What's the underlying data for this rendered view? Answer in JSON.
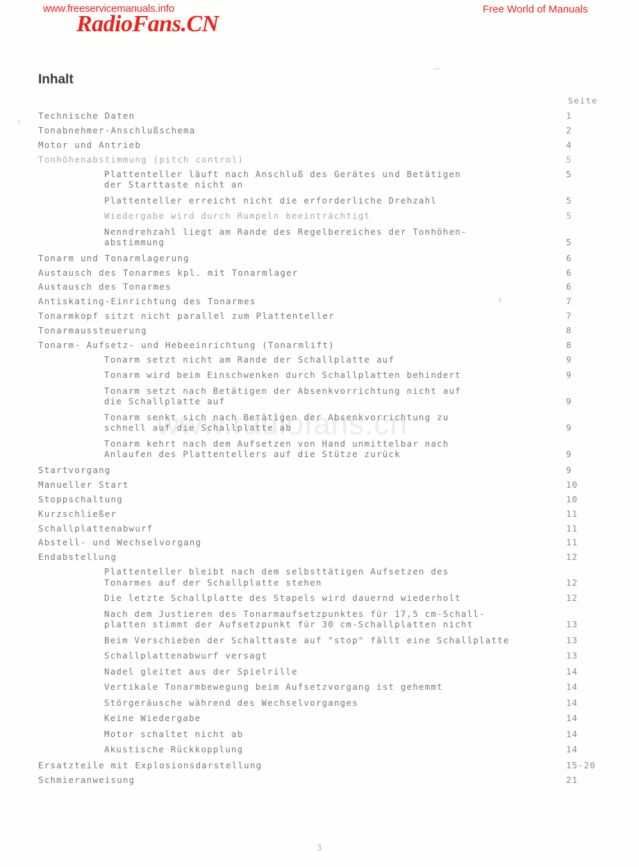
{
  "header": {
    "left_url": "www.freeservicemanuals.info",
    "logo": "RadioFans.CN",
    "right_text": "Free World of Manuals"
  },
  "watermark": "www.radiofans.cn",
  "title": "Inhalt",
  "page_column_header": "Seite",
  "footer_page": "3",
  "entries": [
    {
      "level": 1,
      "lines": [
        "Technische Daten"
      ],
      "page": "1"
    },
    {
      "level": 1,
      "lines": [
        "Tonabnehmer-Anschlußschema"
      ],
      "page": "2"
    },
    {
      "level": 1,
      "lines": [
        "Motor und Antrieb"
      ],
      "page": "4"
    },
    {
      "level": 1,
      "lines": [
        "Tonhöhenabstimmung (pitch control)"
      ],
      "page": "5",
      "faint": true
    },
    {
      "level": 2,
      "lines": [
        "Plattenteller läuft nach Anschluß des Gerätes und Betätigen",
        "der Starttaste nicht an"
      ],
      "page": "5",
      "page_on_line": 0
    },
    {
      "level": 2,
      "lines": [
        "Plattenteller erreicht nicht die erforderliche Drehzahl"
      ],
      "page": "5"
    },
    {
      "level": 2,
      "lines": [
        "Wiedergabe wird durch Rumpeln beeinträchtigt"
      ],
      "page": "5",
      "faint": true
    },
    {
      "level": 2,
      "lines": [
        "Nenndrehzahl liegt am Rande des Regelbereiches der Tonhöhen-",
        "abstimmung"
      ],
      "page": "5",
      "page_on_line": 1
    },
    {
      "level": 1,
      "lines": [
        "Tonarm und Tonarmlagerung"
      ],
      "page": "6"
    },
    {
      "level": 1,
      "lines": [
        "Austausch des Tonarmes kpl. mit Tonarmlager"
      ],
      "page": "6"
    },
    {
      "level": 1,
      "lines": [
        "Austausch des Tonarmes"
      ],
      "page": "6"
    },
    {
      "level": 1,
      "lines": [
        "Antiskating-Einrichtung des Tonarmes"
      ],
      "page": "7"
    },
    {
      "level": 1,
      "lines": [
        "Tonarmkopf sitzt nicht parallel zum Plattenteller"
      ],
      "page": "7"
    },
    {
      "level": 1,
      "lines": [
        "Tonarmaussteuerung"
      ],
      "page": "8"
    },
    {
      "level": 1,
      "lines": [
        "Tonarm- Aufsetz- und Hebeeinrichtung (Tonarmlift)"
      ],
      "page": "8"
    },
    {
      "level": 2,
      "lines": [
        "Tonarm setzt nicht am Rande der Schallplatte auf"
      ],
      "page": "9"
    },
    {
      "level": 2,
      "lines": [
        "Tonarm wird beim Einschwenken durch Schallplatten behindert"
      ],
      "page": "9"
    },
    {
      "level": 2,
      "lines": [
        "Tonarm setzt nach Betätigen der Absenkvorrichtung nicht auf",
        "die Schallplatte auf"
      ],
      "page": "9",
      "page_on_line": 1
    },
    {
      "level": 2,
      "lines": [
        "Tonarm senkt sich nach Betätigen der Absenkvorrichtung zu",
        "schnell auf die Schallplatte ab"
      ],
      "page": "9",
      "page_on_line": 1
    },
    {
      "level": 2,
      "lines": [
        "Tonarm kehrt nach dem Aufsetzen von Hand unmittelbar nach",
        "Anlaufen des Plattentellers auf die Stütze zurück"
      ],
      "page": "9",
      "page_on_line": 1
    },
    {
      "level": 1,
      "lines": [
        "Startvorgang"
      ],
      "page": "9"
    },
    {
      "level": 1,
      "lines": [
        "Manueller Start"
      ],
      "page": "10"
    },
    {
      "level": 1,
      "lines": [
        "Stoppschaltung"
      ],
      "page": "10"
    },
    {
      "level": 1,
      "lines": [
        "Kurzschließer"
      ],
      "page": "11"
    },
    {
      "level": 1,
      "lines": [
        "Schallplattenabwurf"
      ],
      "page": "11"
    },
    {
      "level": 1,
      "lines": [
        "Abstell- und Wechselvorgang"
      ],
      "page": "11"
    },
    {
      "level": 1,
      "lines": [
        "Endabstellung"
      ],
      "page": "12"
    },
    {
      "level": 2,
      "lines": [
        "Plattenteller bleibt nach dem selbsttätigen Aufsetzen des",
        "Tonarmes auf der Schallplatte stehen"
      ],
      "page": "12",
      "page_on_line": 1
    },
    {
      "level": 2,
      "lines": [
        "Die letzte Schallplatte des Stapels wird dauernd wiederholt"
      ],
      "page": "12"
    },
    {
      "level": 2,
      "lines": [
        "Nach dem Justieren des Tonarmaufsetzpunktes für 17,5 cm-Schall-",
        "platten stimmt der Aufsetzpunkt für 30 cm-Schallplatten nicht"
      ],
      "page": "13",
      "page_on_line": 1
    },
    {
      "level": 2,
      "lines": [
        "Beim Verschieben der Schalttaste auf \"stop\" fällt eine Schallplatte"
      ],
      "page": "13"
    },
    {
      "level": 2,
      "lines": [
        "Schallplattenabwurf versagt"
      ],
      "page": "13"
    },
    {
      "level": 2,
      "lines": [
        "Nadel gleitet aus der Spielrille"
      ],
      "page": "14"
    },
    {
      "level": 2,
      "lines": [
        "Vertikale Tonarmbewegung beim Aufsetzvorgang ist gehemmt"
      ],
      "page": "14"
    },
    {
      "level": 2,
      "lines": [
        "Störgeräusche während des Wechselvorganges"
      ],
      "page": "14"
    },
    {
      "level": 2,
      "lines": [
        "Keine Wiedergabe"
      ],
      "page": "14"
    },
    {
      "level": 2,
      "lines": [
        "Motor schaltet nicht ab"
      ],
      "page": "14"
    },
    {
      "level": 2,
      "lines": [
        "Akustische Rückkopplung"
      ],
      "page": "14"
    },
    {
      "level": 1,
      "lines": [
        "Ersatzteile mit Explosionsdarstellung"
      ],
      "page": "15-20"
    },
    {
      "level": 1,
      "lines": [
        "Schmieranweisung"
      ],
      "page": "21"
    }
  ]
}
